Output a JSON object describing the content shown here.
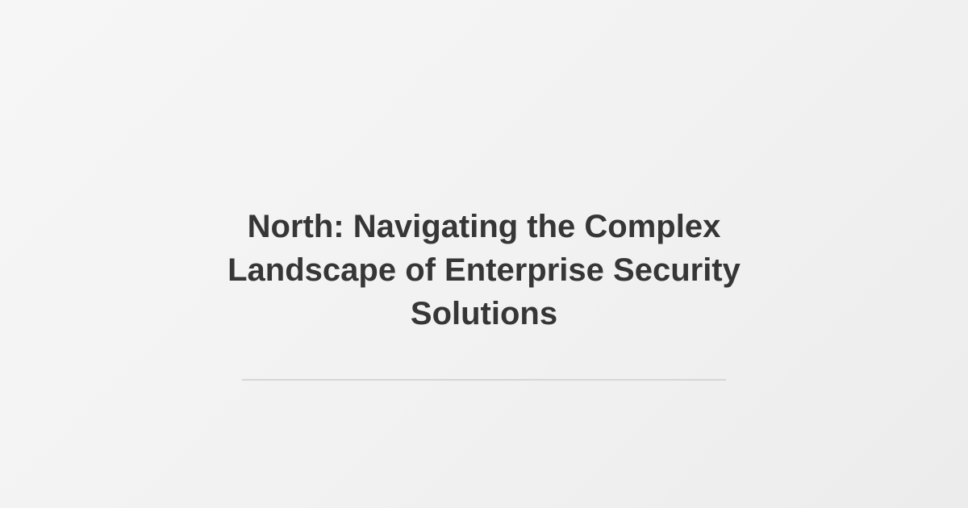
{
  "page": {
    "title": "North: Navigating the Complex Landscape of Enterprise Security Solutions",
    "background_color": "#f1f1f1",
    "text_color": "#363636",
    "divider_color": "#d6d6d6"
  }
}
